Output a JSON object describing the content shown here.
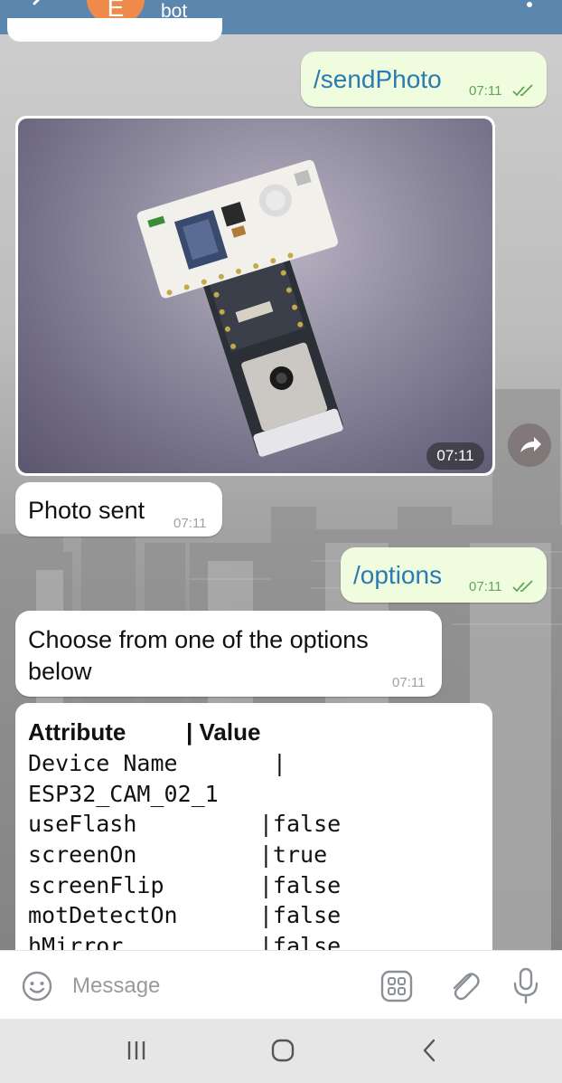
{
  "header": {
    "avatar_letter": "E",
    "subtitle": "bot",
    "back_icon": "back-arrow-icon",
    "menu_icon": "more-vert-icon",
    "color": "#5b86ad"
  },
  "messages": [
    {
      "direction": "out",
      "text": "/sendPhoto",
      "time": "07:11",
      "status": "read"
    },
    {
      "direction": "in",
      "type": "photo",
      "time": "07:11"
    },
    {
      "direction": "in",
      "text": "Photo sent",
      "time": "07:11"
    },
    {
      "direction": "out",
      "text": "/options",
      "time": "07:11",
      "status": "read"
    },
    {
      "direction": "in",
      "text_line1": "Choose from one of the options",
      "text_line2": "below",
      "time": "07:11"
    }
  ],
  "attributes_table": {
    "header_attribute": "Attribute",
    "header_value": "| Value",
    "lines": [
      "Device Name       |",
      "ESP32_CAM_02_1",
      "useFlash         |false",
      "screenOn         |true",
      "screenFlip       |false",
      "motDetectOn      |false",
      "hMirror          |false"
    ]
  },
  "composer": {
    "placeholder": "Message",
    "icons": [
      "emoji-icon",
      "bot-commands-icon",
      "attach-icon",
      "mic-icon"
    ]
  },
  "colors": {
    "incoming_bubble": "#ffffff",
    "outgoing_bubble": "#effdde",
    "command_link": "#2a7ab3",
    "outgoing_time": "#5fa65a"
  }
}
